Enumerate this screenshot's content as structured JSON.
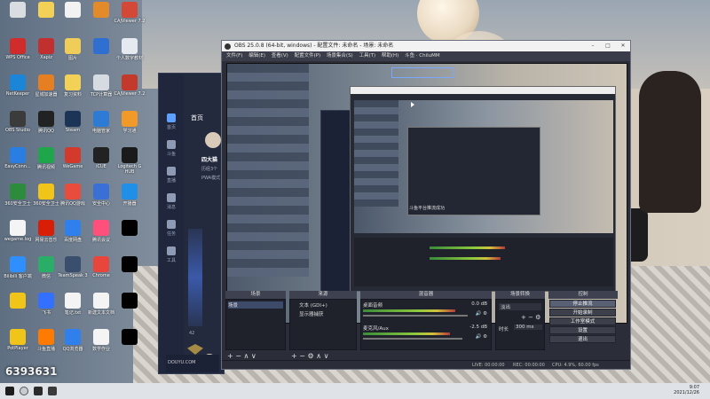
{
  "desktop": {
    "watermark": "6393631",
    "icons": [
      {
        "label": "",
        "color": "#d9dde2"
      },
      {
        "label": "",
        "color": "#f3d056"
      },
      {
        "label": "",
        "color": "#f2f2f2"
      },
      {
        "label": "",
        "color": "#e38b2a"
      },
      {
        "label": "CAJViewer 7.2",
        "color": "#d34836"
      },
      {
        "label": "WPS Office",
        "color": "#d02c2c"
      },
      {
        "label": "Xapiz",
        "color": "#c12f2f"
      },
      {
        "label": "图片",
        "color": "#efcd58"
      },
      {
        "label": "",
        "color": "#2f6fd1"
      },
      {
        "label": "个人数字教材",
        "color": "#e5eaf0"
      },
      {
        "label": "NetKeeper",
        "color": "#1b86d8"
      },
      {
        "label": "星城加速器",
        "color": "#e67e22"
      },
      {
        "label": "复习资料",
        "color": "#f3d056"
      },
      {
        "label": "TCP计算器",
        "color": "#d6dbe1"
      },
      {
        "label": "CAJViewer 7.2",
        "color": "#c33a2d"
      },
      {
        "label": "OBS Studio",
        "color": "#3b3b3b"
      },
      {
        "label": "腾讯QQ",
        "color": "#222"
      },
      {
        "label": "Steam",
        "color": "#1c3556"
      },
      {
        "label": "电脑管家",
        "color": "#2e7bd6"
      },
      {
        "label": "学习通",
        "color": "#f19a2a"
      },
      {
        "label": "EasyConn...",
        "color": "#2a7de1"
      },
      {
        "label": "腾讯视频",
        "color": "#1fa64a"
      },
      {
        "label": "WeGame",
        "color": "#d33a2c"
      },
      {
        "label": "iCUE",
        "color": "#222"
      },
      {
        "label": "Logitech G HUB",
        "color": "#1a1a1a"
      },
      {
        "label": "360安全卫士",
        "color": "#2d8c3c"
      },
      {
        "label": "360安全卫士",
        "color": "#f0c419"
      },
      {
        "label": "腾讯QQ游戏",
        "color": "#e84c3d"
      },
      {
        "label": "安全中心",
        "color": "#3a6fd6"
      },
      {
        "label": "开播器",
        "color": "#1f8fe8"
      },
      {
        "label": "wegame.log",
        "color": "#f4f4f4"
      },
      {
        "label": "网易云音乐",
        "color": "#d81e06"
      },
      {
        "label": "百度网盘",
        "color": "#2f80ed"
      },
      {
        "label": "腾讯会议",
        "color": "#ff4f7a"
      },
      {
        "label": "",
        "color": "#000"
      },
      {
        "label": "Bilibili 客户端",
        "color": "#2f8fff"
      },
      {
        "label": "微信",
        "color": "#2aae67"
      },
      {
        "label": "TeamSpeak 3",
        "color": "#3a4f6d"
      },
      {
        "label": "Chrome",
        "color": "#e8453c"
      },
      {
        "label": "",
        "color": "#000"
      },
      {
        "label": "",
        "color": "#f0c419"
      },
      {
        "label": "飞书",
        "color": "#3370ff"
      },
      {
        "label": "笔记.txt",
        "color": "#f4f4f4"
      },
      {
        "label": "新建文本文档",
        "color": "#f4f4f4"
      },
      {
        "label": "",
        "color": "#000"
      },
      {
        "label": "PotPlayer",
        "color": "#f0c419"
      },
      {
        "label": "斗鱼直播",
        "color": "#ff7a00"
      },
      {
        "label": "QQ浏览器",
        "color": "#2f80ed"
      },
      {
        "label": "数学作业",
        "color": "#f4f4f4"
      },
      {
        "label": "",
        "color": "#000"
      }
    ]
  },
  "left_app": {
    "title": "首页",
    "nav": [
      "首页",
      "斗鱼",
      "直播",
      "消息",
      "任务",
      "工具"
    ],
    "user_name": "四大猫",
    "user_sub": "历经3个",
    "pwa": "PWA模式",
    "views": "42",
    "footer": "DOUYU.COM"
  },
  "obs": {
    "title": "OBS 25.0.8 (64-bit, windows) - 配置文件: 未命名 - 场景: 未命名",
    "menu": [
      "文件(F)",
      "编辑(E)",
      "查看(V)",
      "配置文件(P)",
      "场景集合(S)",
      "工具(T)",
      "帮助(H)",
      "斗鱼 · ChiluMM"
    ],
    "docks": {
      "scenes": "场景",
      "sources": "来源",
      "mixer": "混音器",
      "transitions": "场景转换",
      "controls": "控制"
    },
    "scene_item": "场景",
    "sources_list": [
      "文本 (GDI+)",
      "显示器捕获"
    ],
    "mixer": [
      {
        "name": "桌面音频",
        "db": "0.0 dB",
        "level": 0.88
      },
      {
        "name": "麦克风/Aux",
        "db": "-2.5 dB",
        "level": 0.83
      }
    ],
    "transition": {
      "type": "淡出",
      "duration_label": "时长",
      "duration": "300 ms"
    },
    "controls": [
      "停止推流",
      "开始录制",
      "工作室模式",
      "设置",
      "退出"
    ],
    "status": {
      "live": "LIVE: 00:00:00",
      "rec": "REC: 00:00:00",
      "cpu": "CPU: 4.9%, 60.00 fps"
    },
    "nested_hint": "斗鱼平台推流成功"
  },
  "taskbar": {
    "time": "9:07",
    "date": "2021/12/26"
  }
}
